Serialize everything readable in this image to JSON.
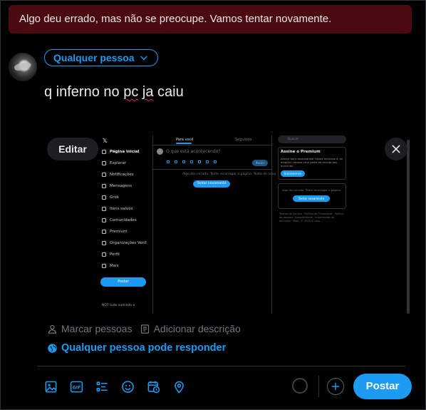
{
  "error_banner": {
    "text": "Algo deu errado, mas não se preocupe. Vamos tentar novamente."
  },
  "composer": {
    "audience_label": "Qualquer pessoa",
    "text_before": "q inferno no ",
    "text_typo1": "pc",
    "text_between": " ",
    "text_typo2": "ja",
    "text_after": " caiu"
  },
  "media": {
    "edit_label": "Editar",
    "close_icon": "close-icon",
    "screenshot": {
      "nav_items": [
        "Página Inicial",
        "Explorar",
        "Notificações",
        "Mensagens",
        "Grok",
        "Itens salvos",
        "Comunidades",
        "Premium",
        "Organizações Verif.",
        "Perfil",
        "Mais"
      ],
      "post_button": "Postar",
      "account": "NOT tudo sumindo o",
      "tab_for_you": "Para você",
      "tab_following": "Seguindo",
      "compose_placeholder": "O que está acontecendo?",
      "error_text": "Algo deu errado. Tente recarregar a página. Tente de novo.",
      "retry": "Tentar novamente",
      "search_placeholder": "Buscar",
      "premium_title": "Assine o Premium",
      "premium_text": "Assine para desbloquear novos recursos e, se elegível, receba uma parte da receita dos anúncios.",
      "subscribe": "Inscrever-se",
      "side_error": "Algo deu errado. Tente recarregar a página.",
      "footer": "Termos de Serviço · Política de Privacidade · Política de cookies · Acessibilidade · Informações de anúncios · Mais · © 2025 X Corp."
    }
  },
  "media_actions": {
    "tag_people": "Marcar pessoas",
    "add_description": "Adicionar descrição"
  },
  "reply_setting": "Qualquer pessoa pode responder",
  "toolbar": {
    "icons": [
      "image-icon",
      "gif-icon",
      "poll-icon",
      "emoji-icon",
      "schedule-icon",
      "location-icon"
    ]
  },
  "post_button": "Postar",
  "colors": {
    "accent": "#1d9bf0",
    "error_bg": "#4a0a0f",
    "background": "#000000"
  }
}
